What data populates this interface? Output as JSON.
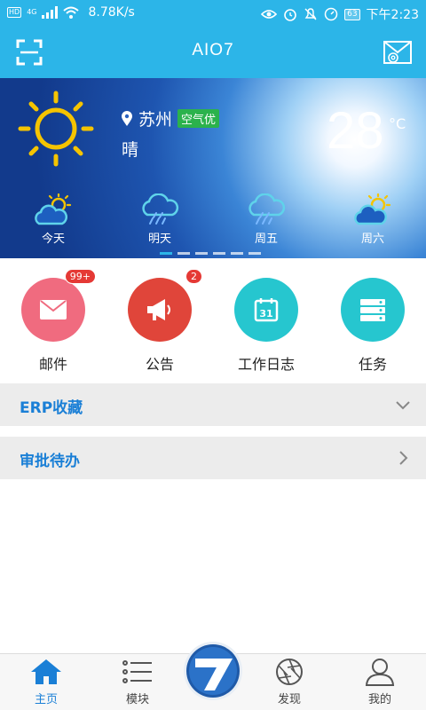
{
  "status_bar": {
    "hd": "HD",
    "network": "4G",
    "speed": "8.78K/s",
    "battery": "63",
    "time": "下午2:23"
  },
  "header": {
    "title": "AIO7",
    "left_icon": "scan-icon",
    "right_icon": "mail-at-icon"
  },
  "weather": {
    "city": "苏州",
    "air_quality": "空气优",
    "condition": "晴",
    "temperature": "28",
    "unit": "°C",
    "forecast": [
      {
        "label": "今天",
        "icon": "partly-cloudy-icon"
      },
      {
        "label": "明天",
        "icon": "rain-icon"
      },
      {
        "label": "周五",
        "icon": "rain-icon"
      },
      {
        "label": "周六",
        "icon": "partly-cloudy-icon"
      }
    ],
    "page_count": 6,
    "active_page": 0
  },
  "quick": [
    {
      "label": "邮件",
      "badge": "99+",
      "color": "#f06b7f",
      "icon": "envelope-icon"
    },
    {
      "label": "公告",
      "badge": "2",
      "color": "#e0453a",
      "icon": "megaphone-icon"
    },
    {
      "label": "工作日志",
      "badge": "",
      "color": "#26c6cf",
      "icon": "calendar-icon"
    },
    {
      "label": "任务",
      "badge": "",
      "color": "#26c6cf",
      "icon": "task-list-icon"
    }
  ],
  "sections": [
    {
      "label": "ERP收藏",
      "icon": "chevron-down-icon"
    },
    {
      "label": "审批待办",
      "icon": "chevron-right-icon"
    }
  ],
  "nav": {
    "home": "主页",
    "modules": "模块",
    "discover": "发现",
    "mine": "我的"
  },
  "colors": {
    "primary": "#2cb5e8",
    "link": "#1a7fd6",
    "badge": "#e53935"
  }
}
